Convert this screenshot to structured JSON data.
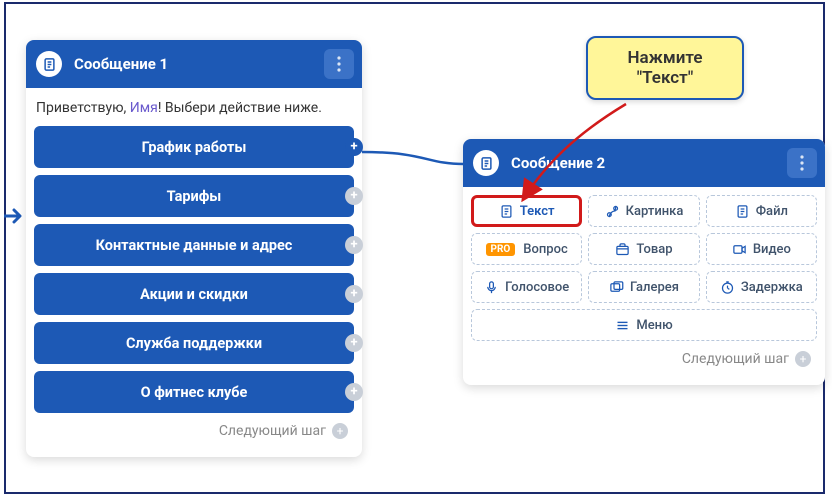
{
  "card1": {
    "title": "Сообщение 1",
    "greeting_pre": "Приветствую, ",
    "greeting_var": "Имя",
    "greeting_post": "! Выбери действие ниже.",
    "buttons": [
      "График работы",
      "Тарифы",
      "Контактные данные и адрес",
      "Акции и скидки",
      "Служба поддержки",
      "О фитнес клубе"
    ],
    "next_step": "Следующий шаг"
  },
  "card2": {
    "title": "Сообщение 2",
    "chips": {
      "text": "Текст",
      "image": "Картинка",
      "file": "Файл",
      "pro": "PRO",
      "question": "Вопрос",
      "product": "Товар",
      "video": "Видео",
      "voice": "Голосовое",
      "gallery": "Галерея",
      "delay": "Задержка",
      "menu": "Меню"
    },
    "next_step": "Следующий шаг"
  },
  "callout": {
    "line1": "Нажмите",
    "line2": "\"Текст\""
  }
}
